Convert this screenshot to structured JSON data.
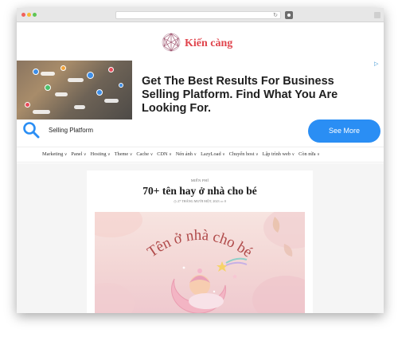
{
  "site": {
    "name": "Kiến càng"
  },
  "ad": {
    "headline": "Get The Best Results For Business Selling Platform. Find What You Are Looking For.",
    "keyword": "Selling Platform",
    "cta_label": "See More"
  },
  "nav": {
    "items": [
      {
        "label": "Marketing",
        "has_dropdown": true
      },
      {
        "label": "Panel",
        "has_dropdown": true
      },
      {
        "label": "Hosting",
        "has_dropdown": true
      },
      {
        "label": "Theme",
        "has_dropdown": true
      },
      {
        "label": "Cache",
        "has_dropdown": true
      },
      {
        "label": "CDN",
        "has_dropdown": true
      },
      {
        "label": "Nén ảnh",
        "has_dropdown": true
      },
      {
        "label": "LazyLoad",
        "has_dropdown": true
      },
      {
        "label": "Chuyển host",
        "has_dropdown": true
      },
      {
        "label": "Lập trình web",
        "has_dropdown": true
      },
      {
        "label": "Còn nữa",
        "has_dropdown": true
      }
    ]
  },
  "post": {
    "category": "MIỄN PHÍ",
    "title": "70+ tên hay ở nhà cho bé",
    "date": "27 THÁNG MƯỜI MỘT, 2023",
    "comments": "0",
    "image_caption": "Tên ở nhà cho bé"
  },
  "colors": {
    "brand": "#e0454d",
    "cta": "#2a8ef4",
    "search_icon": "#2a8ef4"
  }
}
